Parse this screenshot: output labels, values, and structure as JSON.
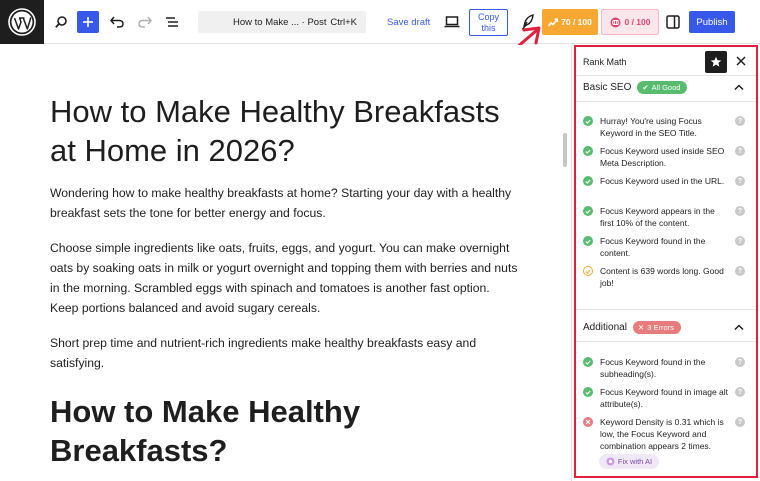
{
  "toolbar": {
    "doc_title": "How to Make ...",
    "doc_type": "· Post",
    "shortcut": "Ctrl+K",
    "save_draft": "Save draft",
    "copy_line1": "Copy",
    "copy_line2": "this",
    "seo_score": "70 / 100",
    "readability_score": "0 / 100",
    "publish": "Publish"
  },
  "editor": {
    "title": "How to Make Healthy Breakfasts at Home in 2026?",
    "p1": "Wondering how to make healthy breakfasts at home? Starting your day with a healthy breakfast sets the tone for better energy and focus.",
    "p2": "Choose simple ingredients like oats, fruits, eggs, and yogurt. You can make overnight oats by soaking oats in milk or yogurt overnight and topping them with berries and nuts in the morning. Scrambled eggs with spinach and tomatoes is another fast option. Keep portions balanced and avoid sugary cereals.",
    "p3": "Short prep time and nutrient-rich ingredients make healthy breakfasts easy and satisfying.",
    "h2": "How to Make Healthy Breakfasts?"
  },
  "sidebar": {
    "header": "Rank Math",
    "basic_seo": {
      "title": "Basic SEO",
      "badge": "All Good",
      "items": [
        "Hurray! You're using Focus Keyword in the SEO Title.",
        "Focus Keyword used inside SEO Meta Description.",
        "Focus Keyword used in the URL.",
        "Focus Keyword appears in the first 10% of the content.",
        "Focus Keyword found in the content.",
        "Content is 639 words long. Good job!"
      ]
    },
    "additional": {
      "title": "Additional",
      "badge": "3 Errors",
      "items": [
        "Focus Keyword found in the subheading(s).",
        "Focus Keyword found in image alt attribute(s).",
        "Keyword Density is 0.31 which is low, the Focus Keyword and combination appears 2 times."
      ],
      "fix_ai": "Fix with AI"
    }
  },
  "colors": {
    "accent": "#3858e9",
    "seo_score_bg": "#f6a832",
    "good": "#58bb6f",
    "error": "#e87c7c",
    "highlight": "#e0203c"
  }
}
